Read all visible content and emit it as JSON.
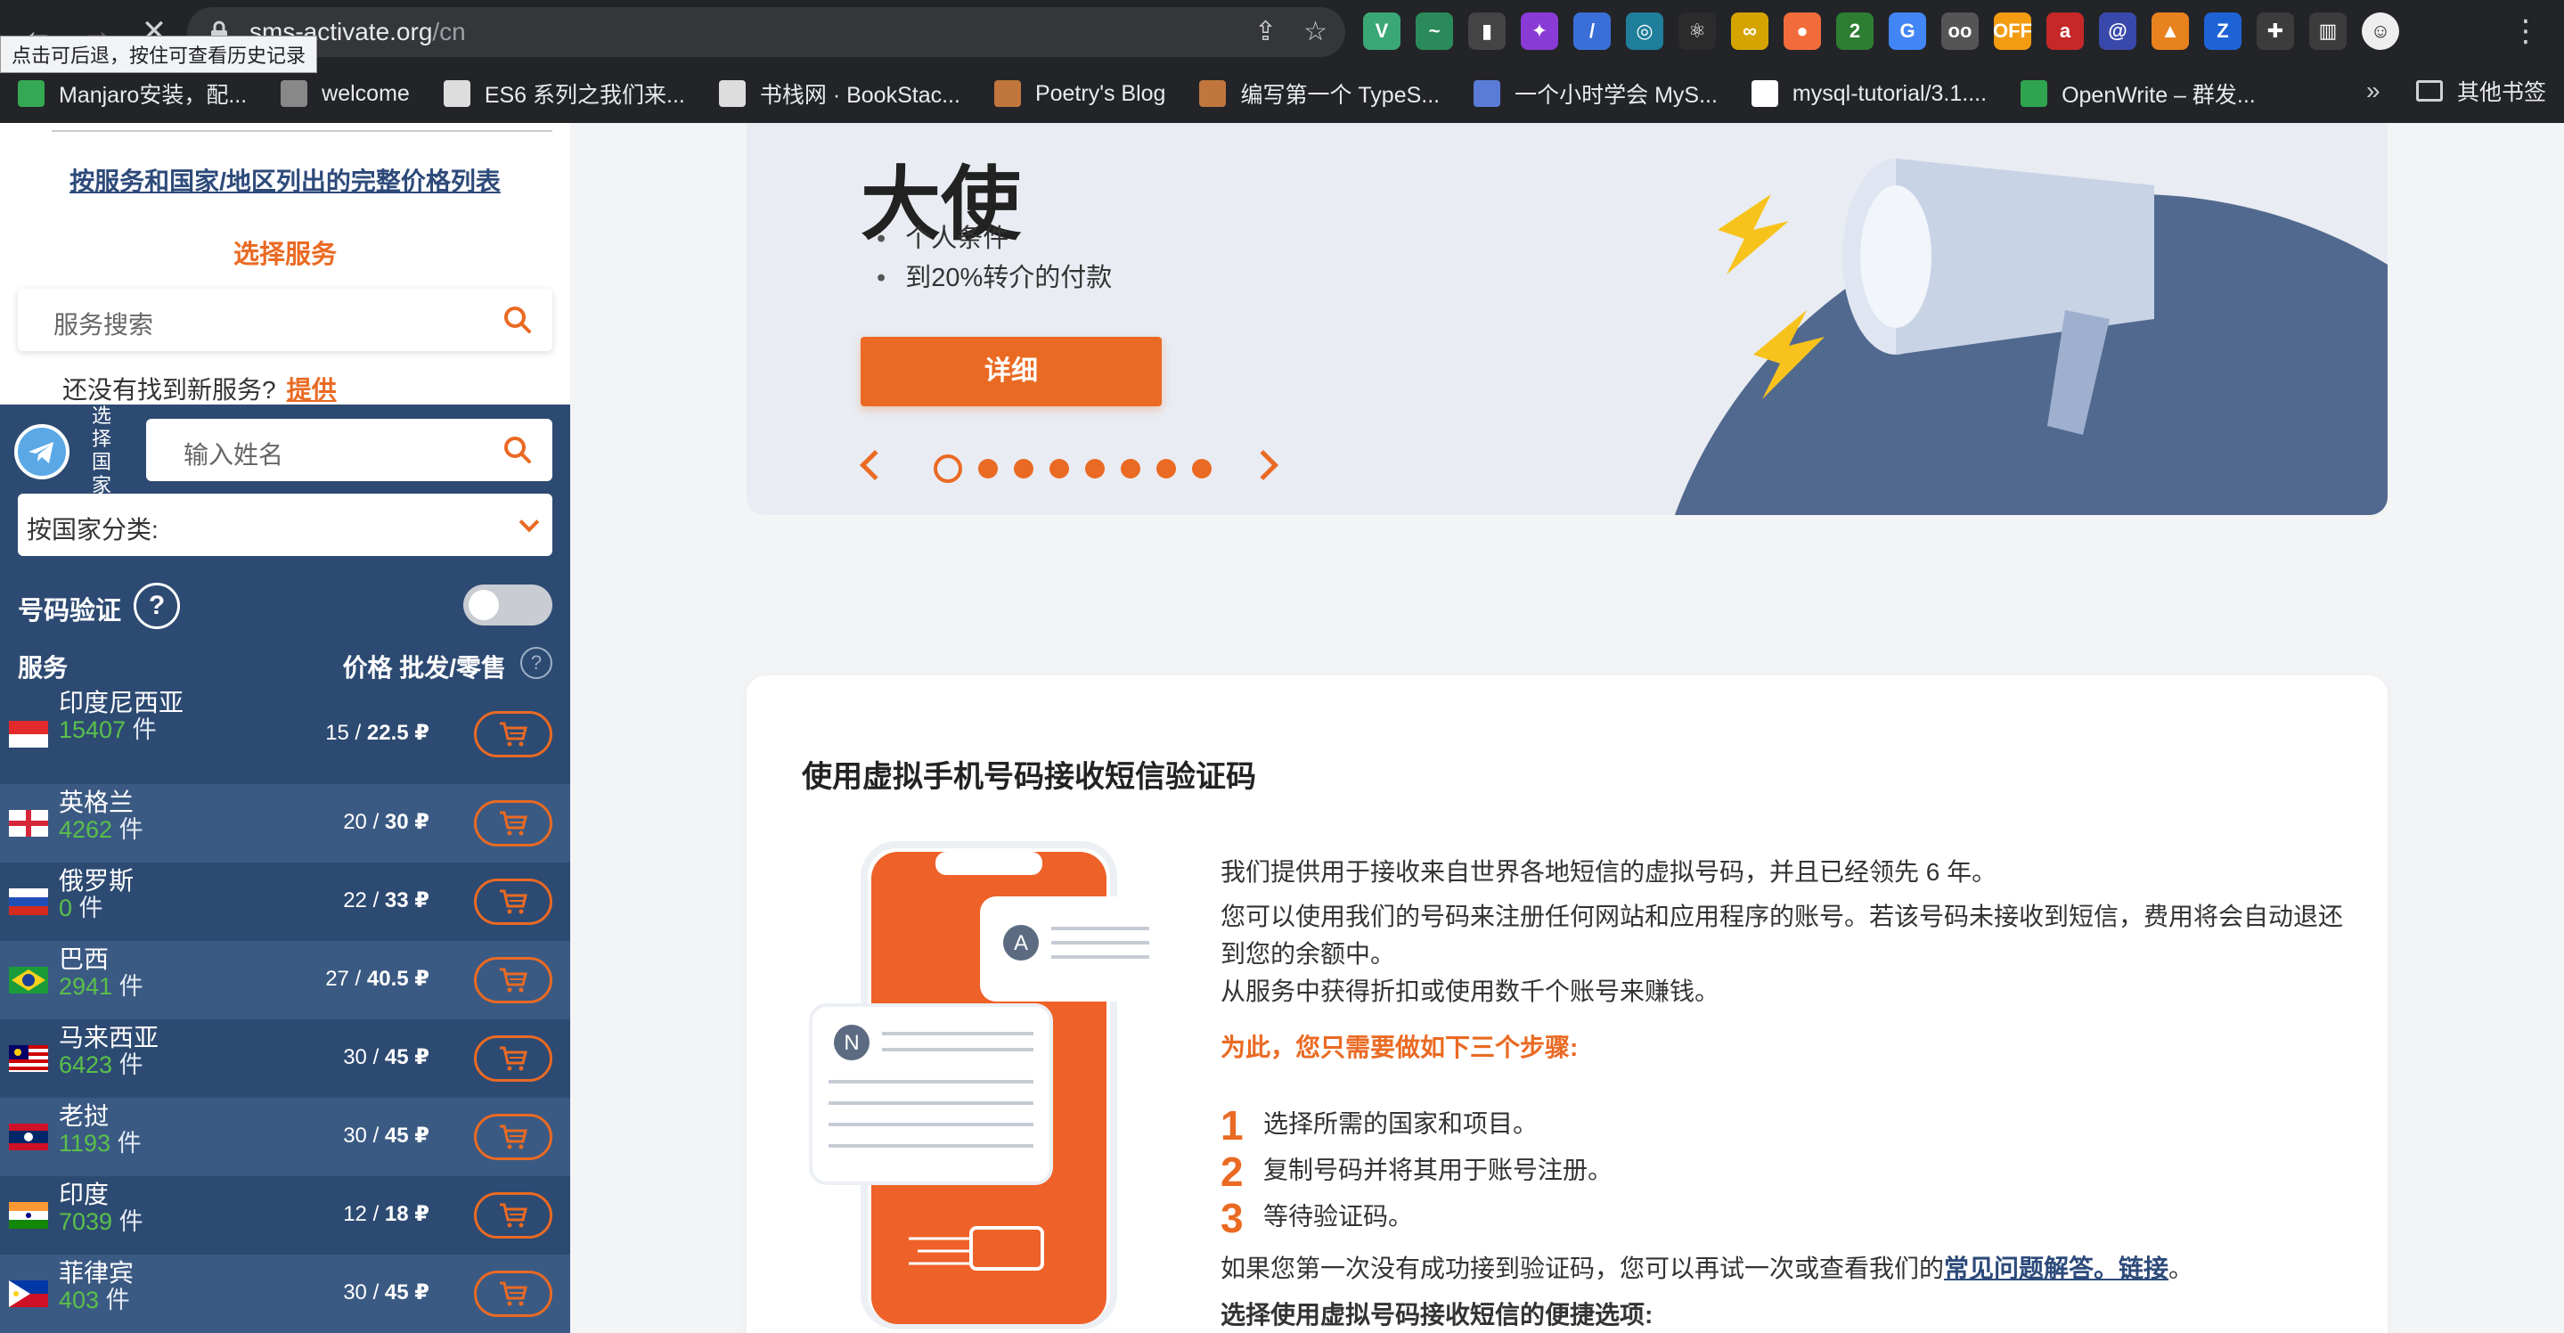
{
  "browser": {
    "tooltip": "点击可后退，按住可查看历史记录",
    "url_domain": "sms-activate.org",
    "url_path": "/cn",
    "extensions": [
      {
        "name": "vue-icon",
        "label": "V",
        "color": "#3ba776"
      },
      {
        "name": "wave-icon",
        "label": "~",
        "color": "#2b8a5a"
      },
      {
        "name": "bookmark-ext-icon",
        "label": "▮",
        "color": "#444"
      },
      {
        "name": "pinwheel-icon",
        "label": "✦",
        "color": "#8a3bd6"
      },
      {
        "name": "feather-icon",
        "label": "/",
        "color": "#3a6fd8"
      },
      {
        "name": "globe-icon",
        "label": "◎",
        "color": "#1f7f9a"
      },
      {
        "name": "react-icon",
        "label": "⚛",
        "color": "#2c2c2c"
      },
      {
        "name": "infinity-icon",
        "label": "∞",
        "color": "#d6a400"
      },
      {
        "name": "orange-ext-icon",
        "label": "●",
        "color": "#f26b3a"
      },
      {
        "name": "network-icon",
        "label": "2",
        "color": "#2e7d32"
      },
      {
        "name": "translate-icon",
        "label": "G",
        "color": "#4285f4"
      },
      {
        "name": "reader-icon",
        "label": "oo",
        "color": "#555"
      },
      {
        "name": "off-icon",
        "label": "OFF",
        "color": "#f39c12"
      },
      {
        "name": "red-ext-icon",
        "label": "a",
        "color": "#c62828"
      },
      {
        "name": "at-icon",
        "label": "@",
        "color": "#3949ab"
      },
      {
        "name": "fox-icon",
        "label": "▲",
        "color": "#e8821e"
      },
      {
        "name": "z-icon",
        "label": "Z",
        "color": "#1e63d6"
      },
      {
        "name": "puzzle-icon",
        "label": "✚",
        "color": "#3c3c3c"
      },
      {
        "name": "sidebar-icon",
        "label": "▥",
        "color": "#3c3c3c"
      },
      {
        "name": "profile-avatar",
        "label": "☺",
        "color": "#eeeeee"
      }
    ],
    "bookmarks": [
      {
        "label": "Manjaro安装，配...",
        "color": "#34a853"
      },
      {
        "label": "welcome",
        "color": "#888888"
      },
      {
        "label": "ES6 系列之我们来...",
        "color": "#dddddd"
      },
      {
        "label": "书栈网 · BookStac...",
        "color": "#dddddd"
      },
      {
        "label": "Poetry's Blog",
        "color": "#c0763c"
      },
      {
        "label": "编写第一个 TypeS...",
        "color": "#c0763c"
      },
      {
        "label": "一个小时学会 MyS...",
        "color": "#5b7cd6"
      },
      {
        "label": "mysql-tutorial/3.1....",
        "color": "#ffffff"
      },
      {
        "label": "OpenWrite – 群发...",
        "color": "#2ea44f"
      }
    ],
    "more": "»",
    "other_bookmarks": "其他书签"
  },
  "sidebar": {
    "price_list_link": "按服务和国家/地区列出的完整价格列表",
    "choose_service": "选择服务",
    "service_search_placeholder": "服务搜索",
    "not_found_text": "还没有找到新服务?",
    "not_found_link": "提供",
    "vertical_label": "选择国家",
    "name_input_placeholder": "输入姓名",
    "country_select": "按国家分类:",
    "verify_label": "号码验证",
    "help_symbol": "?",
    "col_service": "服务",
    "col_price": "价格 批发/零售",
    "countries": [
      {
        "name": "印度尼西亚",
        "count": "15407",
        "unit": "件",
        "wholesale": "15",
        "retail": "22.5",
        "currency": "₽"
      },
      {
        "name": "英格兰",
        "count": "4262",
        "unit": "件",
        "wholesale": "20",
        "retail": "30",
        "currency": "₽"
      },
      {
        "name": "俄罗斯",
        "count": "0",
        "unit": "件",
        "wholesale": "22",
        "retail": "33",
        "currency": "₽"
      },
      {
        "name": "巴西",
        "count": "2941",
        "unit": "件",
        "wholesale": "27",
        "retail": "40.5",
        "currency": "₽"
      },
      {
        "name": "马来西亚",
        "count": "6423",
        "unit": "件",
        "wholesale": "30",
        "retail": "45",
        "currency": "₽"
      },
      {
        "name": "老挝",
        "count": "1193",
        "unit": "件",
        "wholesale": "30",
        "retail": "45",
        "currency": "₽"
      },
      {
        "name": "印度",
        "count": "7039",
        "unit": "件",
        "wholesale": "12",
        "retail": "18",
        "currency": "₽"
      },
      {
        "name": "菲律宾",
        "count": "403",
        "unit": "件",
        "wholesale": "30",
        "retail": "45",
        "currency": "₽"
      }
    ]
  },
  "banner": {
    "title": "大使",
    "items": [
      "个人条件",
      "到20%转介的付款"
    ],
    "detail_button": "详细",
    "slide_count": 8,
    "active_slide": 1
  },
  "card": {
    "title": "使用虚拟手机号码接收短信验证码",
    "p1": "我们提供用于接收来自世界各地短信的虚拟号码，并且已经领先 6 年。",
    "p2": "您可以使用我们的号码来注册任何网站和应用程序的账号。若该号码未接收到短信，费用将会自动退还到您的余额中。",
    "p3": "从服务中获得折扣或使用数千个账号来赚钱。",
    "steps_title": "为此，您只需要做如下三个步骤:",
    "steps": [
      {
        "num": "1",
        "text": "选择所需的国家和项目。"
      },
      {
        "num": "2",
        "text": "复制号码并将其用于账号注册。"
      },
      {
        "num": "3",
        "text": "等待验证码。"
      }
    ],
    "faq_text": "如果您第一次没有成功接到验证码，您可以再试一次或查看我们的",
    "faq_link": "常见问题解答。链接",
    "faq_end": "。",
    "options_line": "选择使用虚拟号码接收短信的便捷选项:",
    "bubble_a": "A",
    "bubble_n": "N"
  },
  "colors": {
    "accent": "#ea6a23",
    "panel": "#2d4a72",
    "link": "#2d4a7a",
    "count_green": "#5ac04a"
  }
}
